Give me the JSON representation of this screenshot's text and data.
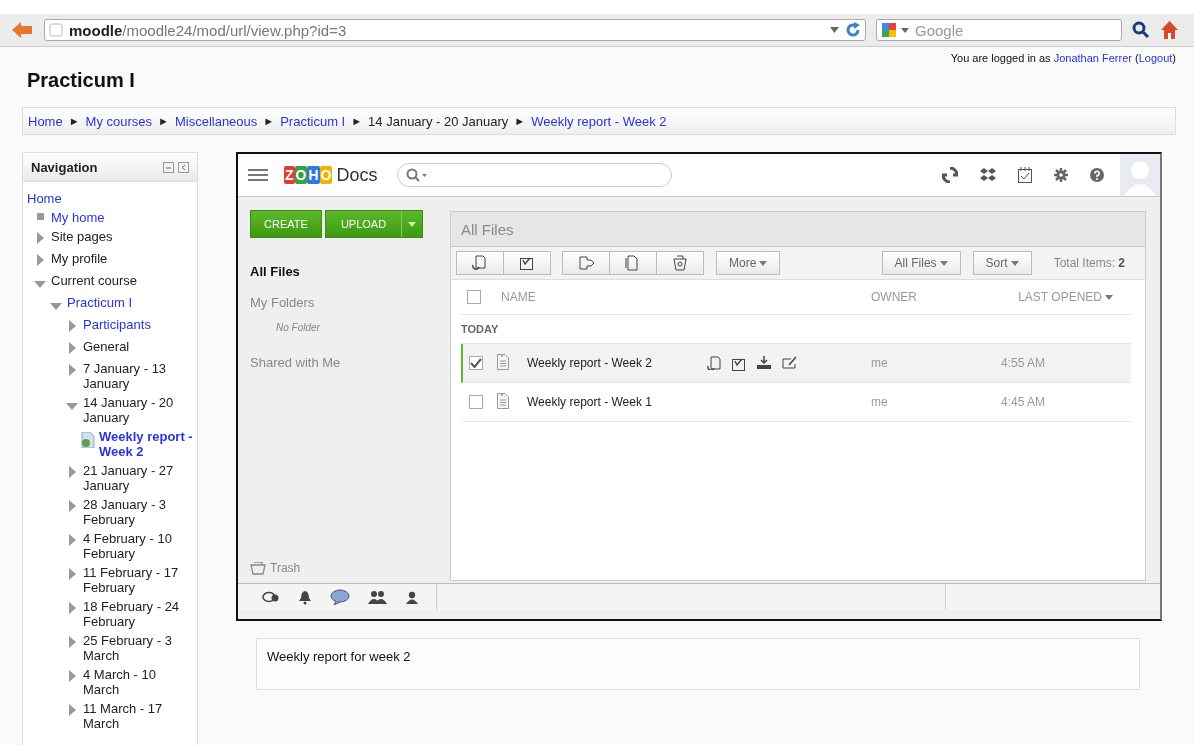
{
  "browser": {
    "url": "**moodle**/moodle24/mod/url/view.php?id=3",
    "search": {
      "placeholder": "Google"
    }
  },
  "header": {
    "title": "Practicum I",
    "login": [
      {
        "text": "You are logged in as",
        "kind": "text"
      },
      {
        "text": "Jonathan Ferrer",
        "kind": "link"
      },
      {
        "text": "(",
        "kind": "text"
      },
      {
        "text": "Logout",
        "kind": "link"
      },
      {
        "text": ")",
        "kind": "text"
      }
    ]
  },
  "breadcrumb": {
    "separator": "►",
    "items": [
      {
        "label": "Home",
        "kind": "link"
      },
      {
        "label": "My courses",
        "kind": "link"
      },
      {
        "label": "Miscellaneous",
        "kind": "link"
      },
      {
        "label": "Practicum I",
        "kind": "link"
      },
      {
        "label": "14 January - 20 January",
        "kind": "text"
      },
      {
        "label": "Weekly report - Week 2",
        "kind": "link"
      }
    ]
  },
  "navigation": {
    "title": "Navigation",
    "items": [
      {
        "label": "Home",
        "link": true,
        "kind": "root"
      },
      {
        "label": "My home",
        "link": true,
        "kind": "leaf"
      },
      {
        "label": "Site pages",
        "link": false,
        "kind": "branch",
        "expanded": false
      },
      {
        "label": "My profile",
        "link": false,
        "kind": "branch",
        "expanded": false
      },
      {
        "label": "Current course",
        "link": false,
        "kind": "branch",
        "expanded": true,
        "children": [
          {
            "label": "Practicum I",
            "link": true,
            "kind": "branch",
            "expanded": true,
            "children": [
              {
                "label": "Participants",
                "link": true,
                "kind": "branch",
                "expanded": false
              },
              {
                "label": "General",
                "link": false,
                "kind": "branch",
                "expanded": false
              },
              {
                "label": "7 January - 13 January",
                "link": false,
                "kind": "branch",
                "expanded": false
              },
              {
                "label": "14 January - 20 January",
                "link": false,
                "kind": "branch",
                "expanded": true,
                "children": [
                  {
                    "label": "Weekly report - Week 2",
                    "link": true,
                    "kind": "activity"
                  }
                ]
              },
              {
                "label": "21 January - 27 January",
                "link": false,
                "kind": "branch",
                "expanded": false
              },
              {
                "label": "28 January - 3 February",
                "link": false,
                "kind": "branch",
                "expanded": false
              },
              {
                "label": "4 February - 10 February",
                "link": false,
                "kind": "branch",
                "expanded": false
              },
              {
                "label": "11 February - 17 February",
                "link": false,
                "kind": "branch",
                "expanded": false
              },
              {
                "label": "18 February - 24 February",
                "link": false,
                "kind": "branch",
                "expanded": false
              },
              {
                "label": "25 February - 3 March",
                "link": false,
                "kind": "branch",
                "expanded": false
              },
              {
                "label": "4 March - 10 March",
                "link": false,
                "kind": "branch",
                "expanded": false
              },
              {
                "label": "11 March - 17 March",
                "link": false,
                "kind": "branch",
                "expanded": false
              }
            ]
          }
        ]
      }
    ]
  },
  "docs": {
    "logo": "ZOHO",
    "brand": "Docs",
    "create": "CREATE",
    "upload": "UPLOAD",
    "sidebar": [
      {
        "label": "All Files",
        "selected": true
      },
      {
        "label": "My Folders",
        "selected": false,
        "empty": "No Folder"
      },
      {
        "label": "Shared with Me",
        "selected": false
      }
    ],
    "all_checked": false,
    "trash": "Trash",
    "title": "All Files",
    "more": "More",
    "filter": "All Files",
    "sort": "Sort",
    "total": "Total Items: **2**",
    "columns": [
      "NAME",
      "OWNER",
      "LAST OPENED"
    ],
    "group": "TODAY",
    "rows": [
      {
        "name": "Weekly report - Week 2",
        "owner": "me",
        "time": "4:55 AM",
        "checked": true,
        "selected": true
      },
      {
        "name": "Weekly report - Week 1",
        "owner": "me",
        "time": "4:45 AM",
        "checked": false,
        "selected": false
      }
    ]
  },
  "description": "Weekly report for week 2"
}
